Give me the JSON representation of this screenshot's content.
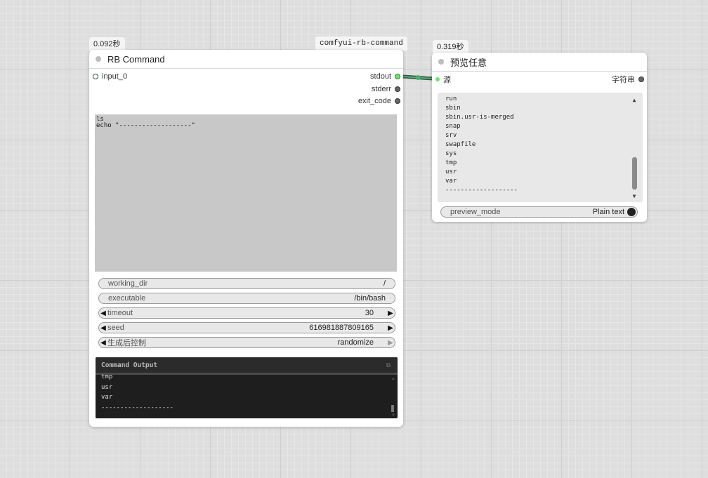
{
  "rb_node": {
    "time_badge": "0.092秒",
    "package_badge": "comfyui-rb-command",
    "title": "RB Command",
    "input": "input_0",
    "outputs": [
      "stdout",
      "stderr",
      "exit_code"
    ],
    "command_lines": "ls\necho \"-------------------\"",
    "widgets": {
      "working_dir": {
        "label": "working_dir",
        "value": "/"
      },
      "executable": {
        "label": "executable",
        "value": "/bin/bash"
      },
      "timeout": {
        "label": "timeout",
        "value": "30"
      },
      "seed": {
        "label": "seed",
        "value": "616981887809165"
      },
      "control": {
        "label": "生成后控制",
        "value": "randomize"
      }
    },
    "console": {
      "title": "Command Output",
      "lines": [
        "tmp",
        "usr",
        "var",
        "-------------------"
      ]
    }
  },
  "preview_node": {
    "time_badge": "0.319秒",
    "title": "预览任意",
    "input": "源",
    "output": "字符串",
    "lines": [
      "run",
      "sbin",
      "sbin.usr-is-merged",
      "snap",
      "srv",
      "swapfile",
      "sys",
      "tmp",
      "usr",
      "var",
      "-------------------"
    ],
    "preview_mode": {
      "label": "preview_mode",
      "value": "Plain text"
    }
  },
  "colors": {
    "link": "#3d7a5a",
    "active_slot": "#6ee36e"
  }
}
